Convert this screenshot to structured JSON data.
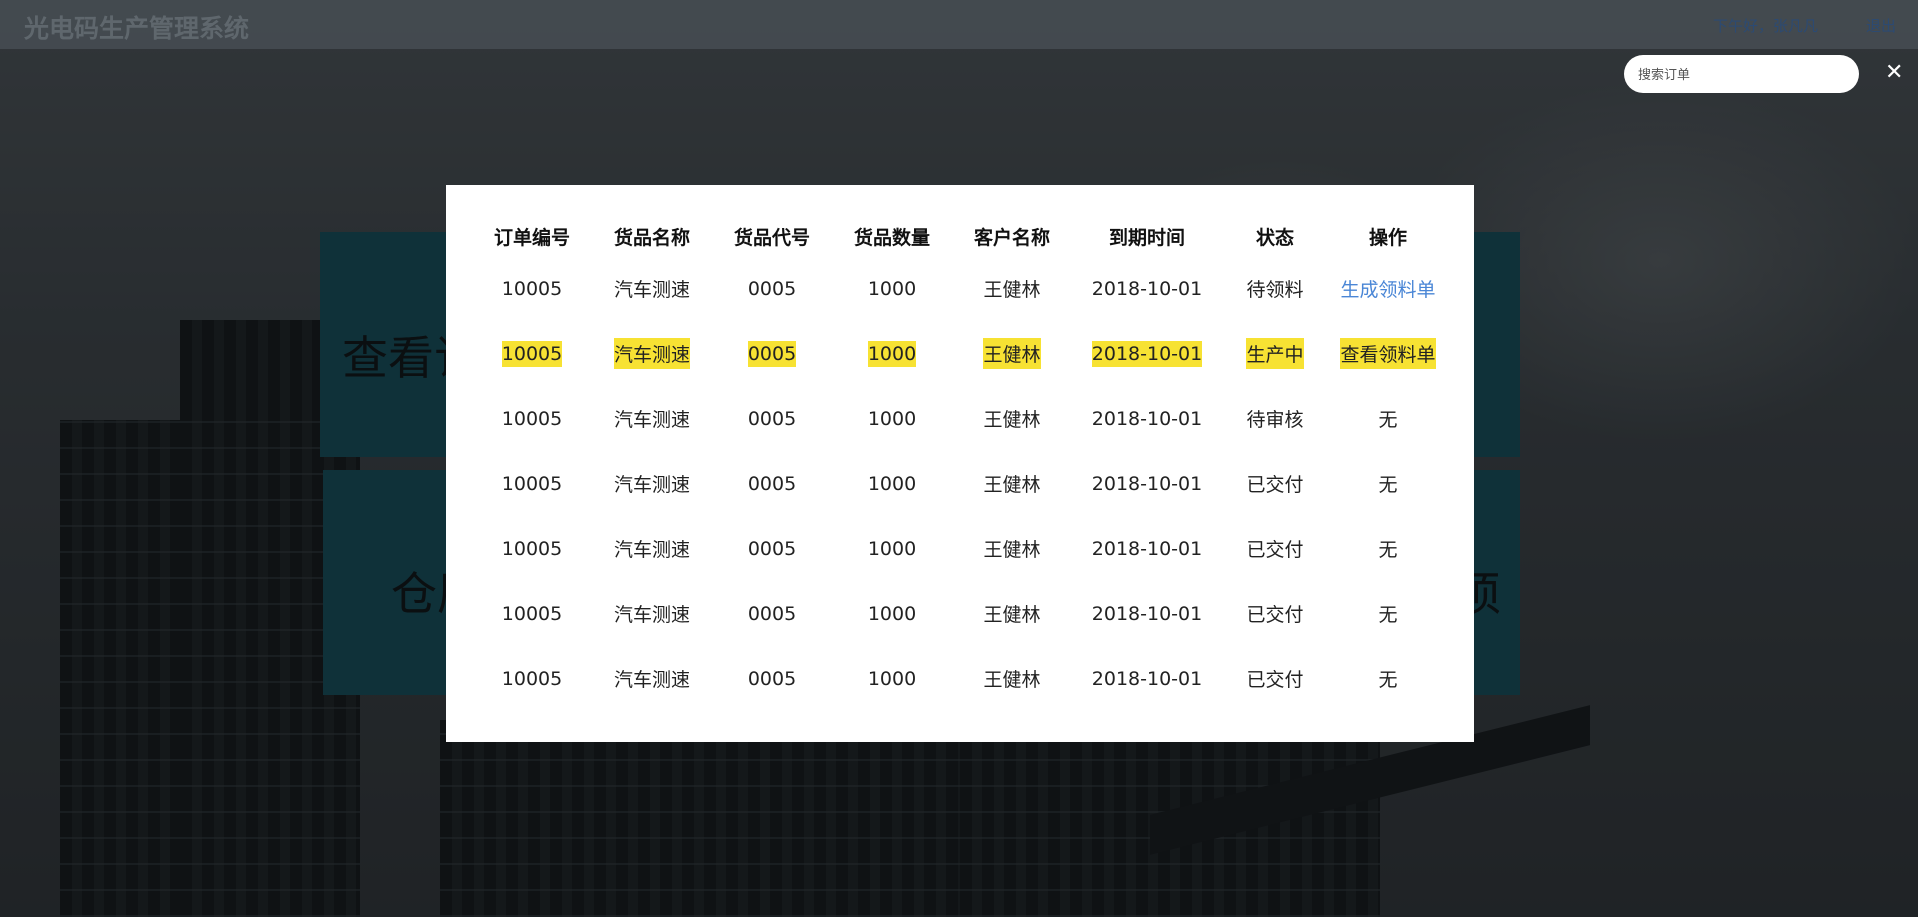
{
  "header": {
    "app_title": "光电码生产管理系统",
    "greeting": "下午好，张凡凡",
    "logout_label": "退出"
  },
  "search": {
    "placeholder": "搜索订单",
    "value": ""
  },
  "close_icon": "close-icon",
  "background_tiles": {
    "tile_1_text": "查看订",
    "tile_2_text_left": "仓原",
    "tile_2_text_right": "须"
  },
  "table": {
    "columns": [
      "订单编号",
      "货品名称",
      "货品代号",
      "货品数量",
      "客户名称",
      "到期时间",
      "状态",
      "操作"
    ],
    "rows": [
      {
        "order_id": "10005",
        "product_name": "汽车测速",
        "product_code": "0005",
        "quantity": "1000",
        "customer": "王健林",
        "due_date": "2018-10-01",
        "status": "待领料",
        "action": "生成领料单",
        "highlighted": false
      },
      {
        "order_id": "10005",
        "product_name": "汽车测速",
        "product_code": "0005",
        "quantity": "1000",
        "customer": "王健林",
        "due_date": "2018-10-01",
        "status": "生产中",
        "action": "查看领料单",
        "highlighted": true
      },
      {
        "order_id": "10005",
        "product_name": "汽车测速",
        "product_code": "0005",
        "quantity": "1000",
        "customer": "王健林",
        "due_date": "2018-10-01",
        "status": "待审核",
        "action": "无",
        "highlighted": false
      },
      {
        "order_id": "10005",
        "product_name": "汽车测速",
        "product_code": "0005",
        "quantity": "1000",
        "customer": "王健林",
        "due_date": "2018-10-01",
        "status": "已交付",
        "action": "无",
        "highlighted": false
      },
      {
        "order_id": "10005",
        "product_name": "汽车测速",
        "product_code": "0005",
        "quantity": "1000",
        "customer": "王健林",
        "due_date": "2018-10-01",
        "status": "已交付",
        "action": "无",
        "highlighted": false
      },
      {
        "order_id": "10005",
        "product_name": "汽车测速",
        "product_code": "0005",
        "quantity": "1000",
        "customer": "王健林",
        "due_date": "2018-10-01",
        "status": "已交付",
        "action": "无",
        "highlighted": false
      },
      {
        "order_id": "10005",
        "product_name": "汽车测速",
        "product_code": "0005",
        "quantity": "1000",
        "customer": "王健林",
        "due_date": "2018-10-01",
        "status": "已交付",
        "action": "无",
        "highlighted": false
      }
    ]
  },
  "colors": {
    "highlight": "#f7e233",
    "link": "#4a86d6",
    "tile": "#1d5a68"
  }
}
